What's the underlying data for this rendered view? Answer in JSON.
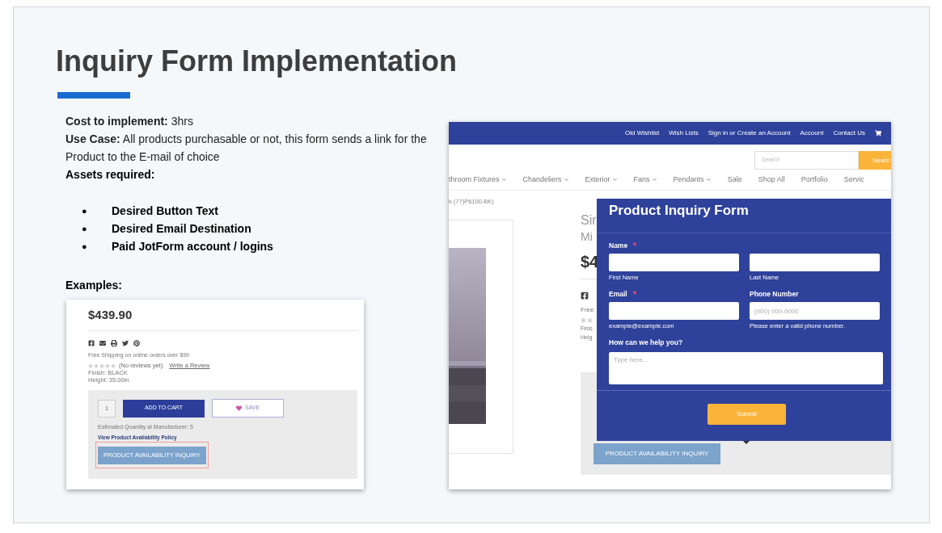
{
  "slide": {
    "title": "Inquiry Form Implementation",
    "details": [
      "**Cost to implement:** 3hrs",
      "**Use Case:** All products purchasable or not, this form sends a link for the Product  to the E-mail of choice"
    ],
    "assets_heading": "Assets required:",
    "bullet": "●",
    "assets": [
      "Desired Button Text",
      "Desired Email Destination",
      "Paid JotForm account / logins"
    ],
    "examples_heading": "Examples:"
  },
  "example_product": {
    "price": "$439.90",
    "shipping": "Free Shipping on online orders over $99",
    "stars": 0,
    "reviews": "(No reviews yet)",
    "write_review": "Write a Review",
    "finish": "Finish: BLACK",
    "height": "Height: 35.00in",
    "quantity": "1",
    "add_to_cart": "ADD TO CART",
    "save": "SAVE",
    "estimated": "Estimated Quantity at Manufacturer: 5",
    "policy_link": "View Product Availability Policy",
    "inquiry_button": "PRODUCT AVAILABILITY INQUIRY",
    "inquiry_highlighted": true
  },
  "example_site": {
    "top_links": [
      "Old Wishlist",
      "Wish Lists",
      "Sign in or Create an Account",
      "Account",
      "Contact Us"
    ],
    "search": {
      "placeholder": "Search",
      "button": "Searc"
    },
    "nav": [
      {
        "label": "throom Fixtures",
        "has_menu": true
      },
      {
        "label": "Chandeliers",
        "has_menu": true
      },
      {
        "label": "Exterior",
        "has_menu": true
      },
      {
        "label": "Fans",
        "has_menu": true
      },
      {
        "label": "Pendants",
        "has_menu": true
      },
      {
        "label": "Sale",
        "has_menu": false
      },
      {
        "label": "Shop All",
        "has_menu": false
      },
      {
        "label": "Portfolio",
        "has_menu": false
      },
      {
        "label": "Servic",
        "has_menu": false
      }
    ],
    "breadcrumb": "k (77)P6100-BK)",
    "product_title": "Sir",
    "product_subtitle": "Mi",
    "price": "$4",
    "shipping": "Free",
    "finish": "Finis",
    "height": "Heig",
    "inquiry_button": "PRODUCT AVAILABILITY INQUIRY",
    "form": {
      "title": "Product Inquiry Form",
      "rows": [
        [
          {
            "label": "Name",
            "required": true,
            "sublabel": "First Name"
          },
          {
            "required": false,
            "sublabel": "Last Name"
          }
        ],
        [
          {
            "label": "Email",
            "required": true,
            "sublabel": "example@example.com"
          },
          {
            "label": "Phone Number",
            "required": false,
            "placeholder": "(000) 000-0000",
            "sublabel": "Please enter a valid phone number."
          }
        ]
      ],
      "question": "How can we help you?",
      "message_placeholder": "Type here...",
      "submit": "Submit"
    }
  }
}
